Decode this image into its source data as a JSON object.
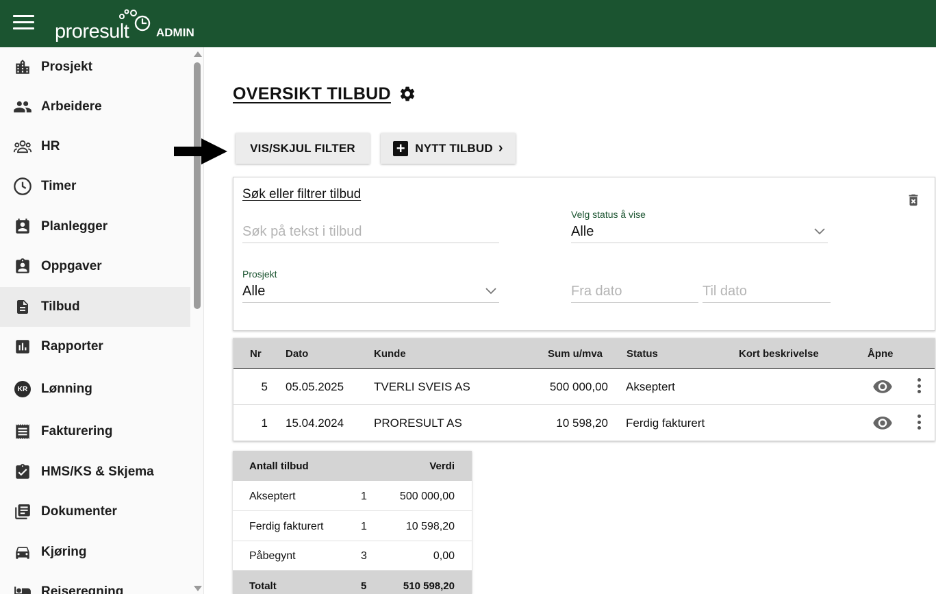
{
  "topbar": {
    "brand": "proresult",
    "role": "ADMIN",
    "color": "#1b5430"
  },
  "sidebar": {
    "items": [
      {
        "label": "Prosjekt",
        "icon": "building-icon"
      },
      {
        "label": "Arbeidere",
        "icon": "people-icon"
      },
      {
        "label": "HR",
        "icon": "group-icon"
      },
      {
        "label": "Timer",
        "icon": "clock-icon"
      },
      {
        "label": "Planlegger",
        "icon": "contact-calendar-icon"
      },
      {
        "label": "Oppgaver",
        "icon": "clipboard-person-icon"
      },
      {
        "label": "Tilbud",
        "icon": "document-icon",
        "active": true
      },
      {
        "label": "Rapporter",
        "icon": "bar-chart-icon"
      },
      {
        "label": "Lønning",
        "icon": "kr-badge-icon",
        "badge": "KR"
      },
      {
        "label": "Fakturering",
        "icon": "receipt-icon"
      },
      {
        "label": "HMS/KS & Skjema",
        "icon": "clipboard-check-icon"
      },
      {
        "label": "Dokumenter",
        "icon": "library-books-icon"
      },
      {
        "label": "Kjøring",
        "icon": "car-icon"
      },
      {
        "label": "Reiseregning",
        "icon": "hotel-icon"
      }
    ]
  },
  "main": {
    "title": "OVERSIKT TILBUD",
    "buttons": {
      "filter": "VIS/SKJUL FILTER",
      "new_offer": "NYTT TILBUD"
    },
    "filter": {
      "title": "Søk eller filtrer tilbud",
      "search_placeholder": "Søk på tekst i tilbud",
      "status_label": "Velg status å vise",
      "status_value": "Alle",
      "project_label": "Prosjekt",
      "project_value": "Alle",
      "from_date_placeholder": "Fra dato",
      "to_date_placeholder": "Til dato"
    },
    "offers": {
      "columns": {
        "nr": "Nr",
        "date": "Dato",
        "customer": "Kunde",
        "sum": "Sum u/mva",
        "status": "Status",
        "description": "Kort beskrivelse",
        "open": "Åpne"
      },
      "rows": [
        {
          "nr": "5",
          "date": "05.05.2025",
          "customer": "TVERLI SVEIS AS",
          "sum": "500 000,00",
          "status": "Akseptert",
          "description": ""
        },
        {
          "nr": "1",
          "date": "15.04.2024",
          "customer": "PRORESULT AS",
          "sum": "10 598,20",
          "status": "Ferdig fakturert",
          "description": ""
        }
      ]
    },
    "summary": {
      "header": {
        "label": "Antall tilbud",
        "value": "Verdi"
      },
      "rows": [
        {
          "label": "Akseptert",
          "count": "1",
          "value": "500 000,00"
        },
        {
          "label": "Ferdig fakturert",
          "count": "1",
          "value": "10 598,20"
        },
        {
          "label": "Påbegynt",
          "count": "3",
          "value": "0,00"
        }
      ],
      "total": {
        "label": "Totalt",
        "count": "5",
        "value": "510 598,20"
      }
    }
  }
}
